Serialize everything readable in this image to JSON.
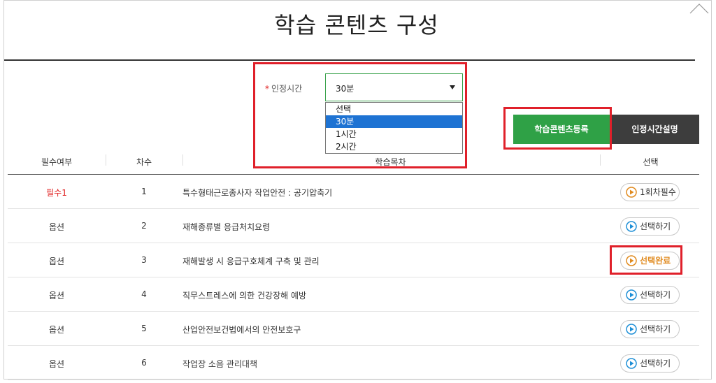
{
  "page": {
    "title": "학습 콘텐츠 구성"
  },
  "time": {
    "required_mark": "*",
    "label": "인정시간",
    "selected": "30분",
    "options": [
      "선택",
      "30분",
      "1시간",
      "2시간"
    ]
  },
  "buttons": {
    "register": "학습콘텐츠등록",
    "explain": "인정시간설명"
  },
  "table": {
    "headers": {
      "required": "필수여부",
      "order": "차수",
      "title": "학습목차",
      "select": "선택"
    },
    "rows": [
      {
        "required": "필수1",
        "order": "1",
        "title": "특수형태근로종사자 작업안전 : 공기압축기",
        "action": "1회차필수",
        "action_state": "required"
      },
      {
        "required": "옵션",
        "order": "2",
        "title": "재해종류별 응급처치요령",
        "action": "선택하기",
        "action_state": "select"
      },
      {
        "required": "옵션",
        "order": "3",
        "title": "재해발생 시 응급구호체계 구축 및 관리",
        "action": "선택완료",
        "action_state": "done"
      },
      {
        "required": "옵션",
        "order": "4",
        "title": "직무스트레스에 의한 건강장해 예방",
        "action": "선택하기",
        "action_state": "select"
      },
      {
        "required": "옵션",
        "order": "5",
        "title": "산업안전보건법에서의 안전보호구",
        "action": "선택하기",
        "action_state": "select"
      },
      {
        "required": "옵션",
        "order": "6",
        "title": "작업장 소음 관리대책",
        "action": "선택하기",
        "action_state": "select"
      }
    ]
  },
  "colors": {
    "accent_green": "#2fa146",
    "highlight_red": "#e0202a",
    "selected_blue": "#1e73d3",
    "done_orange": "#e08a1e",
    "play_blue": "#1e8fd6"
  }
}
